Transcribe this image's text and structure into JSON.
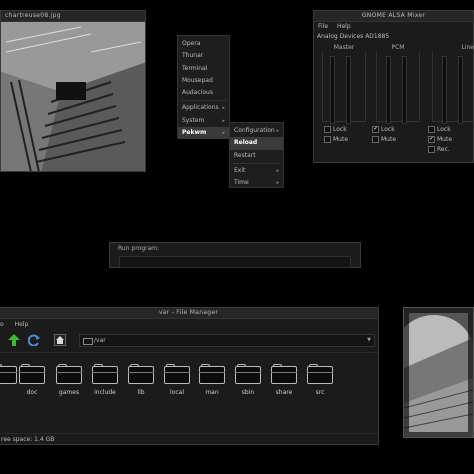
{
  "image_viewer": {
    "title": "chartreuse08.jpg"
  },
  "main_menu": {
    "items": [
      {
        "label": "Opera",
        "submenu": false
      },
      {
        "label": "Thunar",
        "submenu": false
      },
      {
        "label": "Terminal",
        "submenu": false
      },
      {
        "label": "Mousepad",
        "submenu": false
      },
      {
        "label": "Audacious",
        "submenu": false
      },
      {
        "label": "Applications",
        "submenu": true
      },
      {
        "label": "System",
        "submenu": true
      },
      {
        "label": "Pekwm",
        "submenu": true,
        "selected": true
      }
    ]
  },
  "pekwm_menu": {
    "items": [
      {
        "label": "Configuration",
        "submenu": true
      },
      {
        "label": "Reload",
        "submenu": false,
        "selected": true
      },
      {
        "label": "Restart",
        "submenu": false
      },
      {
        "label": "Exit",
        "submenu": true
      },
      {
        "label": "Time",
        "submenu": true
      }
    ]
  },
  "mixer": {
    "title": "GNOME ALSA Mixer",
    "menu": [
      "File",
      "Help"
    ],
    "device": "Analog Devices AD1885",
    "channels": [
      {
        "name": "Master",
        "lock_label": "Lock",
        "lock": false,
        "mute_label": "Mute",
        "mute": false
      },
      {
        "name": "PCM",
        "lock_label": "Lock",
        "lock": true,
        "mute_label": "Mute",
        "mute": false
      },
      {
        "name": "Line",
        "lock_label": "Lock",
        "lock": false,
        "mute_label": "Mute",
        "mute": true,
        "rec_label": "Rec.",
        "rec": false
      }
    ]
  },
  "run_dialog": {
    "label": "Run program:",
    "value": ""
  },
  "file_manager": {
    "title": "var - File Manager",
    "menu": [
      "o",
      "Help"
    ],
    "path": "/var",
    "folders": [
      "",
      "doc",
      "games",
      "include",
      "lib",
      "local",
      "man",
      "sbin",
      "share",
      "src"
    ],
    "status": "ree space: 1.4 GB"
  },
  "colors": {
    "background": "#000000",
    "window_bg": "#1b1b1b",
    "text": "#cccccc",
    "up_arrow": "#3dbb2e",
    "refresh": "#4a8fd8"
  },
  "icons": {
    "up": "up-arrow-icon",
    "refresh": "refresh-icon",
    "home": "home-icon",
    "folder": "folder-icon"
  }
}
